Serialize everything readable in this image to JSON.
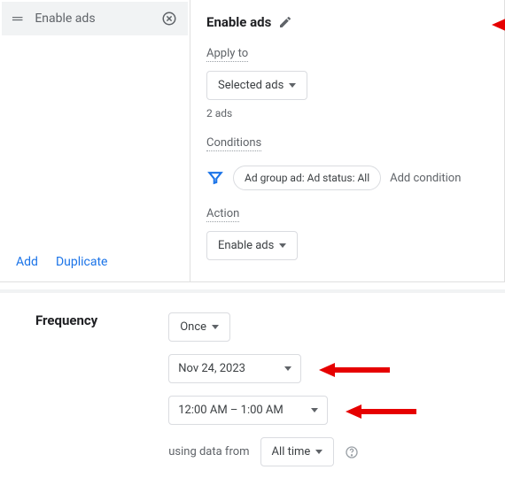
{
  "leftPanel": {
    "ruleLabel": "Enable ads",
    "addLabel": "Add",
    "duplicateLabel": "Duplicate"
  },
  "title": "Enable ads",
  "applyTo": {
    "label": "Apply to",
    "dropdown": "Selected ads",
    "count": "2 ads"
  },
  "conditions": {
    "label": "Conditions",
    "pill": "Ad group ad: Ad status: All",
    "addLabel": "Add condition"
  },
  "action": {
    "label": "Action",
    "dropdown": "Enable ads"
  },
  "frequency": {
    "label": "Frequency",
    "interval": "Once",
    "date": "Nov 24, 2023",
    "time": "12:00 AM – 1:00 AM",
    "usingLabel": "using data from",
    "range": "All time"
  }
}
